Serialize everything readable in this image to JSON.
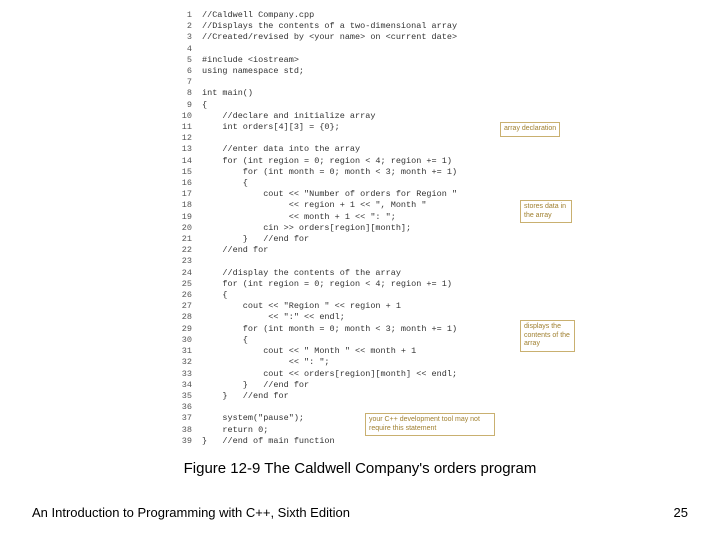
{
  "code": {
    "lines": [
      {
        "n": "1",
        "t": "//Caldwell Company.cpp"
      },
      {
        "n": "2",
        "t": "//Displays the contents of a two-dimensional array"
      },
      {
        "n": "3",
        "t": "//Created/revised by <your name> on <current date>"
      },
      {
        "n": "4",
        "t": ""
      },
      {
        "n": "5",
        "t": "#include <iostream>"
      },
      {
        "n": "6",
        "t": "using namespace std;"
      },
      {
        "n": "7",
        "t": ""
      },
      {
        "n": "8",
        "t": "int main()"
      },
      {
        "n": "9",
        "t": "{"
      },
      {
        "n": "10",
        "t": "    //declare and initialize array"
      },
      {
        "n": "11",
        "t": "    int orders[4][3] = {0};"
      },
      {
        "n": "12",
        "t": ""
      },
      {
        "n": "13",
        "t": "    //enter data into the array"
      },
      {
        "n": "14",
        "t": "    for (int region = 0; region < 4; region += 1)"
      },
      {
        "n": "15",
        "t": "        for (int month = 0; month < 3; month += 1)"
      },
      {
        "n": "16",
        "t": "        {"
      },
      {
        "n": "17",
        "t": "            cout << \"Number of orders for Region \""
      },
      {
        "n": "18",
        "t": "                 << region + 1 << \", Month \""
      },
      {
        "n": "19",
        "t": "                 << month + 1 << \": \";"
      },
      {
        "n": "20",
        "t": "            cin >> orders[region][month];"
      },
      {
        "n": "21",
        "t": "        }   //end for"
      },
      {
        "n": "22",
        "t": "    //end for"
      },
      {
        "n": "23",
        "t": ""
      },
      {
        "n": "24",
        "t": "    //display the contents of the array"
      },
      {
        "n": "25",
        "t": "    for (int region = 0; region < 4; region += 1)"
      },
      {
        "n": "26",
        "t": "    {"
      },
      {
        "n": "27",
        "t": "        cout << \"Region \" << region + 1"
      },
      {
        "n": "28",
        "t": "             << \":\" << endl;"
      },
      {
        "n": "29",
        "t": "        for (int month = 0; month < 3; month += 1)"
      },
      {
        "n": "30",
        "t": "        {"
      },
      {
        "n": "31",
        "t": "            cout << \" Month \" << month + 1"
      },
      {
        "n": "32",
        "t": "                 << \": \";"
      },
      {
        "n": "33",
        "t": "            cout << orders[region][month] << endl;"
      },
      {
        "n": "34",
        "t": "        }   //end for"
      },
      {
        "n": "35",
        "t": "    }   //end for"
      },
      {
        "n": "36",
        "t": ""
      },
      {
        "n": "37",
        "t": "    system(\"pause\");"
      },
      {
        "n": "38",
        "t": "    return 0;"
      },
      {
        "n": "39",
        "t": "}   //end of main function"
      }
    ]
  },
  "callouts": {
    "c1": "array declaration",
    "c2": "stores data\nin the array",
    "c3": "displays the\ncontents of\nthe array",
    "c4": "your C++ development tool may\nnot require this statement"
  },
  "caption": "Figure 12-9 The Caldwell Company's orders program",
  "footer": {
    "left": "An Introduction to Programming with C++, Sixth Edition",
    "right": "25"
  }
}
